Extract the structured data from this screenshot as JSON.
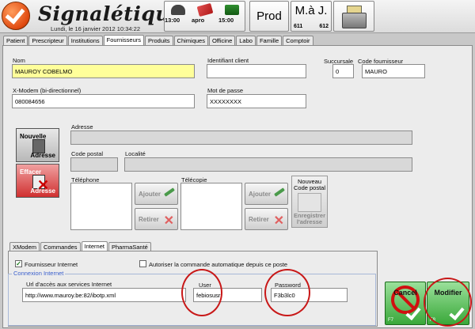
{
  "header": {
    "title": "Signalétiques",
    "date": "Lundi, le 16 janvier 2012 10:34:22",
    "schedule": [
      {
        "label": "13:00",
        "icon": "phone-icon"
      },
      {
        "label": "apro",
        "icon": "pill-icon"
      },
      {
        "label": "15:00",
        "icon": "truck-icon"
      }
    ],
    "prod_label": "Prod",
    "maj": {
      "label": "M.à J.",
      "count1": "611",
      "count2": "612"
    },
    "register_icon": "cash-register-icon"
  },
  "tabs": [
    "Patient",
    "Prescripteur",
    "Institutions",
    "Fournisseurs",
    "Produits",
    "Chimiques",
    "Officine",
    "Labo",
    "Famille",
    "Comptoir"
  ],
  "active_tab": "Fournisseurs",
  "form": {
    "nom_label": "Nom",
    "nom_value": "MAUROY COBELMO",
    "identifiant_label": "Identifiant client",
    "identifiant_value": "",
    "succursale_label": "Succursale",
    "succursale_value": "0",
    "code_fournisseur_label": "Code fournisseur",
    "code_fournisseur_value": "MAURO",
    "xmodem_label": "X-Modem (bi-directionnel)",
    "xmodem_value": "080084656",
    "password_label": "Mot de passe",
    "password_value": "XXXXXXXX",
    "adresse_label": "Adresse",
    "code_postal_label": "Code postal",
    "localite_label": "Localité",
    "telephone_label": "Téléphone",
    "telecopie_label": "Télécopie"
  },
  "buttons": {
    "nouvelle_line1": "Nouvelle",
    "nouvelle_line2": "Adresse",
    "effacer_line1": "Effacer",
    "effacer_line2": "Adresse",
    "ajouter": "Ajouter",
    "retirer": "Retirer",
    "nouveau_code_postal": "Nouveau Code postal",
    "enregistrer_adresse": "Enregistrer l'adresse",
    "cancel": "Cancel",
    "cancel_key": "F7",
    "modifier": "Modifier",
    "modifier_key": "F8"
  },
  "subtabs": [
    "XModem",
    "Commandes",
    "Internet",
    "PharmaSanté"
  ],
  "active_subtab": "Internet",
  "internet": {
    "fournisseur_internet_label": "Fournisseur Internet",
    "fournisseur_internet_checked": true,
    "auto_commande_label": "Autoriser la commande automatique depuis ce poste",
    "auto_commande_checked": false,
    "group_label": "Connexion Internet",
    "url_label": "Url d'accès aux services Internet",
    "url_value": "http://www.mauroy.be:82/ibotp.xml",
    "user_label": "User",
    "user_value": "febiosusr",
    "password_label": "Password",
    "password_value": "F3b3lc0"
  },
  "colors": {
    "highlight": "#ffff9a",
    "annotation_red": "#c81818",
    "action_green": "#3aa83a"
  }
}
